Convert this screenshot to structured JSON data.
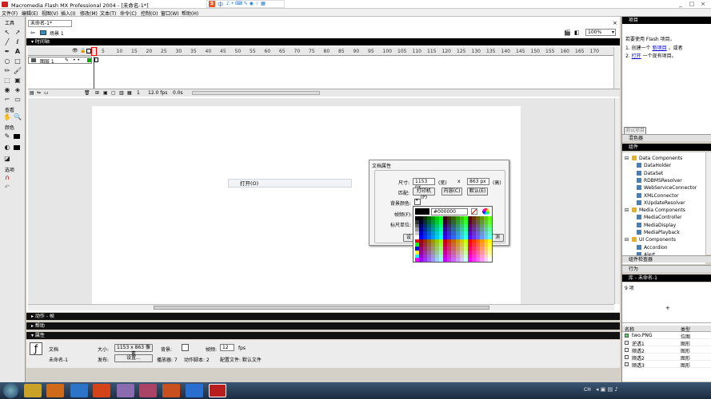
{
  "title": "Macromedia Flash MX Professional 2004 - [未命名-1*]",
  "ime": {
    "brand": "S",
    "lang": "中"
  },
  "window_buttons": [
    "_",
    "□",
    "×"
  ],
  "menu": [
    "文件(F)",
    "编辑(E)",
    "视图(V)",
    "插入(I)",
    "修改(M)",
    "文本(T)",
    "命令(C)",
    "控制(O)",
    "窗口(W)",
    "帮助(H)"
  ],
  "tools": {
    "header": "工具",
    "view": "查看",
    "colors": "颜色",
    "options": "选项"
  },
  "document": {
    "tab": "未命名-1*",
    "scene": "场景 1",
    "zoom": "100%"
  },
  "timeline": {
    "header": "时间轴",
    "layer": "图层 1",
    "ruler": [
      "5",
      "10",
      "15",
      "20",
      "25",
      "30",
      "35",
      "40",
      "45",
      "50",
      "55",
      "60",
      "65",
      "70",
      "75",
      "80",
      "85",
      "90",
      "95",
      "100",
      "105",
      "110",
      "115",
      "120",
      "125",
      "130",
      "135",
      "140",
      "145",
      "150",
      "155",
      "160",
      "165",
      "170"
    ],
    "frame": "1",
    "fps": "12.0 fps",
    "time": "0.0s"
  },
  "context_item": "打开(O)",
  "dialog": {
    "title": "文档属性",
    "size_label": "尺寸:",
    "width": "1153 px",
    "width_unit": "(宽)",
    "x": "x",
    "height": "863 px",
    "height_unit": "(高)",
    "match_label": "匹配:",
    "btn_printer": "打印机(P)",
    "btn_contents": "内容(C)",
    "btn_default": "默认(E)",
    "bg_label": "背景颜色:",
    "fps_label": "帧频(F):",
    "ruler_label": "标尺单位:",
    "ok_btn": "设",
    "cancel_btn": "消",
    "color_hex": "#000000"
  },
  "bottom_panels": {
    "actions": "动作 - 帧",
    "help": "帮助",
    "properties": "属性"
  },
  "props": {
    "doc": "文档",
    "docname": "未命名-1",
    "size_label": "大小:",
    "size_val": "1153 x 863 像素",
    "bg_label": "背景:",
    "fps_label": "帧频:",
    "fps_val": "12",
    "fps_unit": "fps",
    "publish_label": "发布:",
    "settings_btn": "设置...",
    "player": "播放器: 7",
    "as": "动作脚本: 2",
    "profile": "配置文件: 默认文件"
  },
  "right": {
    "project_header": "项目",
    "project_lines": [
      "若要使用 Flash 项目，",
      "1. 创建一个",
      "新项目",
      "，或者",
      "2.",
      "打开",
      "一个现有项目。"
    ],
    "project_btn": "测试项目",
    "mixer": "混色器",
    "components": "组件",
    "comp_items": [
      {
        "name": "Data Components",
        "group": true
      },
      {
        "name": "DataHolder"
      },
      {
        "name": "DataSet"
      },
      {
        "name": "RDBMSResolver"
      },
      {
        "name": "WebServiceConnector"
      },
      {
        "name": "XMLConnector"
      },
      {
        "name": "XUpdateResolver"
      },
      {
        "name": "Media Components",
        "group": true
      },
      {
        "name": "MediaController"
      },
      {
        "name": "MediaDisplay"
      },
      {
        "name": "MediaPlayback"
      },
      {
        "name": "UI Components",
        "group": true
      },
      {
        "name": "Accordion"
      },
      {
        "name": "Alert"
      }
    ],
    "inspector": "组件检查器",
    "behaviors": "行为",
    "library_header": "库 - 未命名-1",
    "item_count": "9 项",
    "col_name": "名称",
    "col_type": "类型",
    "lib_items": [
      {
        "name": "two.PNG",
        "type": "位图"
      },
      {
        "name": "逆透1",
        "type": "图形"
      },
      {
        "name": "顺透2",
        "type": "图形"
      },
      {
        "name": "顺透2",
        "type": "图形"
      },
      {
        "name": "顺透3",
        "type": "图形"
      }
    ]
  },
  "taskbar": {
    "ime": "CH"
  }
}
